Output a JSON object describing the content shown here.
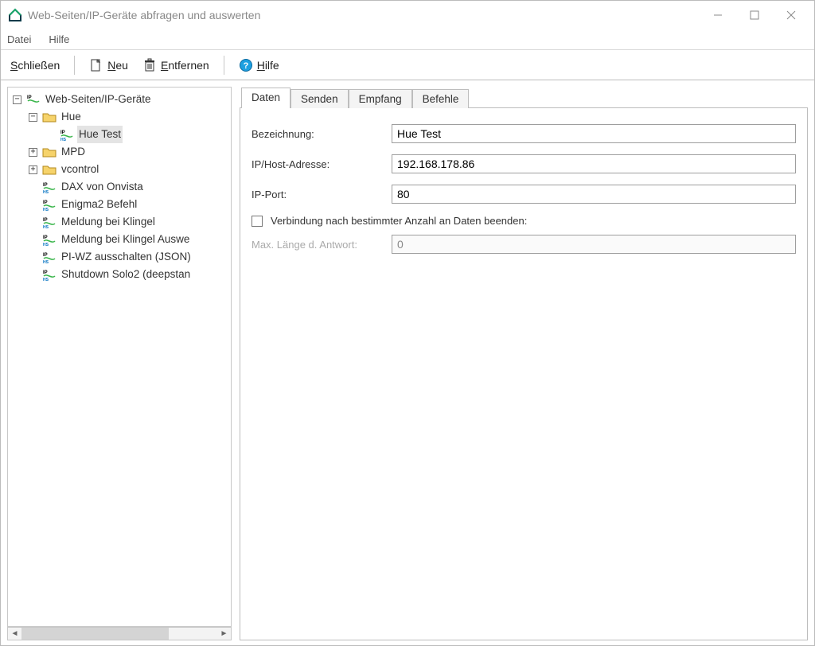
{
  "title": "Web-Seiten/IP-Geräte abfragen und auswerten",
  "menu": {
    "file": "Datei",
    "help": "Hilfe"
  },
  "toolbar": {
    "close": "Schließen",
    "new": "Neu",
    "remove": "Entfernen",
    "help": "Hilfe"
  },
  "tree": {
    "root": "Web-Seiten/IP-Geräte",
    "items": [
      {
        "label": "Hue",
        "type": "folder",
        "expanded": true,
        "children": [
          {
            "label": "Hue Test",
            "type": "ip",
            "selected": true
          }
        ]
      },
      {
        "label": "MPD",
        "type": "folder",
        "expanded": false
      },
      {
        "label": "vcontrol",
        "type": "folder",
        "expanded": false
      },
      {
        "label": "DAX von Onvista",
        "type": "ip"
      },
      {
        "label": "Enigma2 Befehl",
        "type": "ip"
      },
      {
        "label": "Meldung bei Klingel",
        "type": "ip"
      },
      {
        "label": "Meldung bei Klingel Auswe",
        "type": "ip"
      },
      {
        "label": "PI-WZ ausschalten (JSON)",
        "type": "ip"
      },
      {
        "label": "Shutdown Solo2 (deepstan",
        "type": "ip"
      }
    ]
  },
  "tabs": {
    "daten": "Daten",
    "senden": "Senden",
    "empfang": "Empfang",
    "befehle": "Befehle"
  },
  "form": {
    "bezeichnung_label": "Bezeichnung:",
    "bezeichnung_value": "Hue Test",
    "ip_label": "IP/Host-Adresse:",
    "ip_value": "192.168.178.86",
    "port_label": "IP-Port:",
    "port_value": "80",
    "checkbox_label": "Verbindung nach bestimmter Anzahl an Daten beenden:",
    "maxlen_label": "Max. Länge d. Antwort:",
    "maxlen_value": "0"
  }
}
